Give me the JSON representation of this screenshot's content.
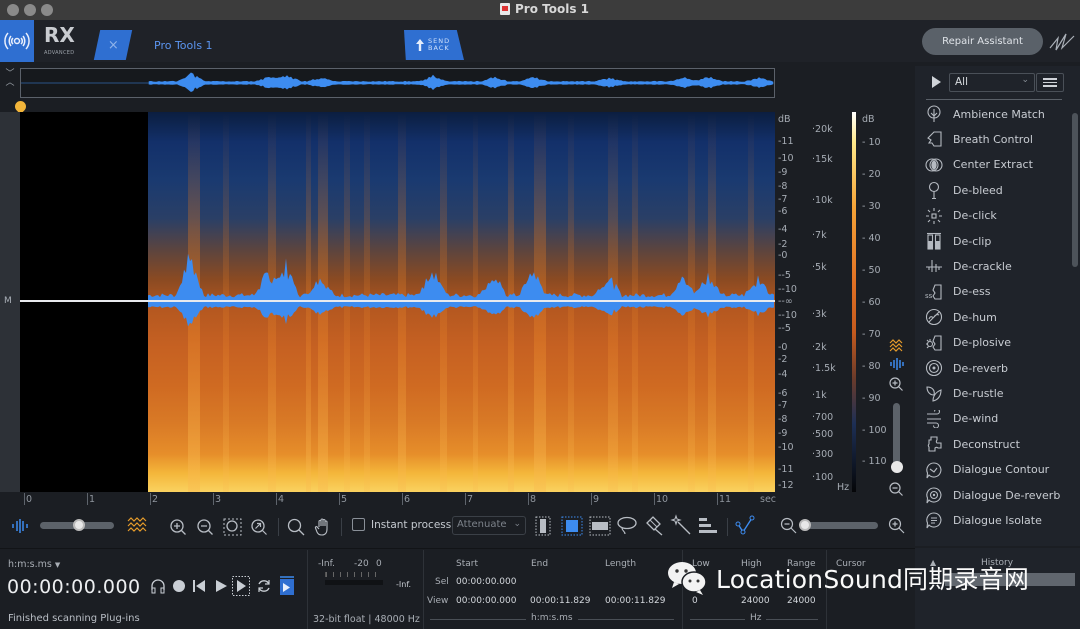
{
  "window": {
    "title": "Pro Tools 1"
  },
  "header": {
    "app_name": "RX",
    "app_edition": "ADVANCED",
    "tab_label": "Pro Tools 1",
    "tab_close": "×",
    "send_back_line1": "SEND",
    "send_back_line2": "BACK",
    "repair_assistant": "Repair Assistant"
  },
  "spectrogram": {
    "channel_label": "M",
    "db_scale": [
      "dB",
      "11",
      "10",
      "9",
      "8",
      "7",
      "6",
      "4",
      "2",
      "0",
      "-5",
      "-10",
      "-∞",
      "-10",
      "-5",
      "0",
      "2",
      "4",
      "6",
      "7",
      "8",
      "9",
      "10",
      "11",
      "12"
    ],
    "hz_scale": [
      "20k",
      "15k",
      "10k",
      "7k",
      "5k",
      "3k",
      "2k",
      "1.5k",
      "1k",
      "700",
      "500",
      "300",
      "100",
      "Hz"
    ],
    "color_scale": [
      "dB",
      "10",
      "20",
      "30",
      "40",
      "50",
      "60",
      "70",
      "80",
      "90",
      "100",
      "110"
    ],
    "time_ruler": [
      "0",
      "1",
      "2",
      "3",
      "4",
      "5",
      "6",
      "7",
      "8",
      "9",
      "10",
      "11",
      "sec"
    ],
    "colors": {
      "accent": "#2f6fd1",
      "waveform": "#3d8cf0",
      "playhead": "#f2b53a"
    }
  },
  "toolbar": {
    "instant_process_label": "Instant process",
    "instant_process_checked": false,
    "mode_select": "Attenuate",
    "time_zoom_slider": 0.5,
    "freq_zoom_slider": 0.05
  },
  "vertical_zoom": {
    "value": 0.05
  },
  "modules": {
    "filter": "All",
    "items": [
      {
        "label": "Ambience Match",
        "icon": "tree-icon"
      },
      {
        "label": "Breath Control",
        "icon": "breath-icon"
      },
      {
        "label": "Center Extract",
        "icon": "circles-icon"
      },
      {
        "label": "De-bleed",
        "icon": "microphone-icon"
      },
      {
        "label": "De-click",
        "icon": "sparkle-icon"
      },
      {
        "label": "De-clip",
        "icon": "clip-icon"
      },
      {
        "label": "De-crackle",
        "icon": "crackle-icon"
      },
      {
        "label": "De-ess",
        "icon": "ess-icon"
      },
      {
        "label": "De-hum",
        "icon": "hum-icon"
      },
      {
        "label": "De-plosive",
        "icon": "plosive-icon"
      },
      {
        "label": "De-reverb",
        "icon": "reverb-icon"
      },
      {
        "label": "De-rustle",
        "icon": "leaf-icon"
      },
      {
        "label": "De-wind",
        "icon": "wind-icon"
      },
      {
        "label": "Deconstruct",
        "icon": "puzzle-icon"
      },
      {
        "label": "Dialogue Contour",
        "icon": "contour-icon"
      },
      {
        "label": "Dialogue De-reverb",
        "icon": "dialogue-reverb-icon"
      },
      {
        "label": "Dialogue Isolate",
        "icon": "dialogue-isolate-icon"
      }
    ]
  },
  "transport": {
    "time_format": "h:m:s.ms",
    "time": "00:00:00.000",
    "status": "Finished scanning Plug-ins"
  },
  "meter": {
    "scale": [
      "-Inf.",
      "-20",
      "0"
    ],
    "peak": "-Inf.",
    "format": "32-bit float | 48000 Hz"
  },
  "selection": {
    "headers": [
      "Start",
      "End",
      "Length"
    ],
    "rows": [
      {
        "label": "Sel",
        "start": "00:00:00.000",
        "end": "",
        "length": ""
      },
      {
        "label": "View",
        "start": "00:00:00.000",
        "end": "00:00:11.829",
        "length": "00:00:11.829"
      }
    ],
    "unit": "h:m:s.ms"
  },
  "frequency": {
    "headers": [
      "Low",
      "High",
      "Range"
    ],
    "view": [
      "0",
      "24000",
      "24000"
    ],
    "unit": "Hz"
  },
  "cursor": {
    "header": "Cursor"
  },
  "history": {
    "title": "History"
  },
  "watermark": {
    "text": "LocationSound同期录音网"
  }
}
